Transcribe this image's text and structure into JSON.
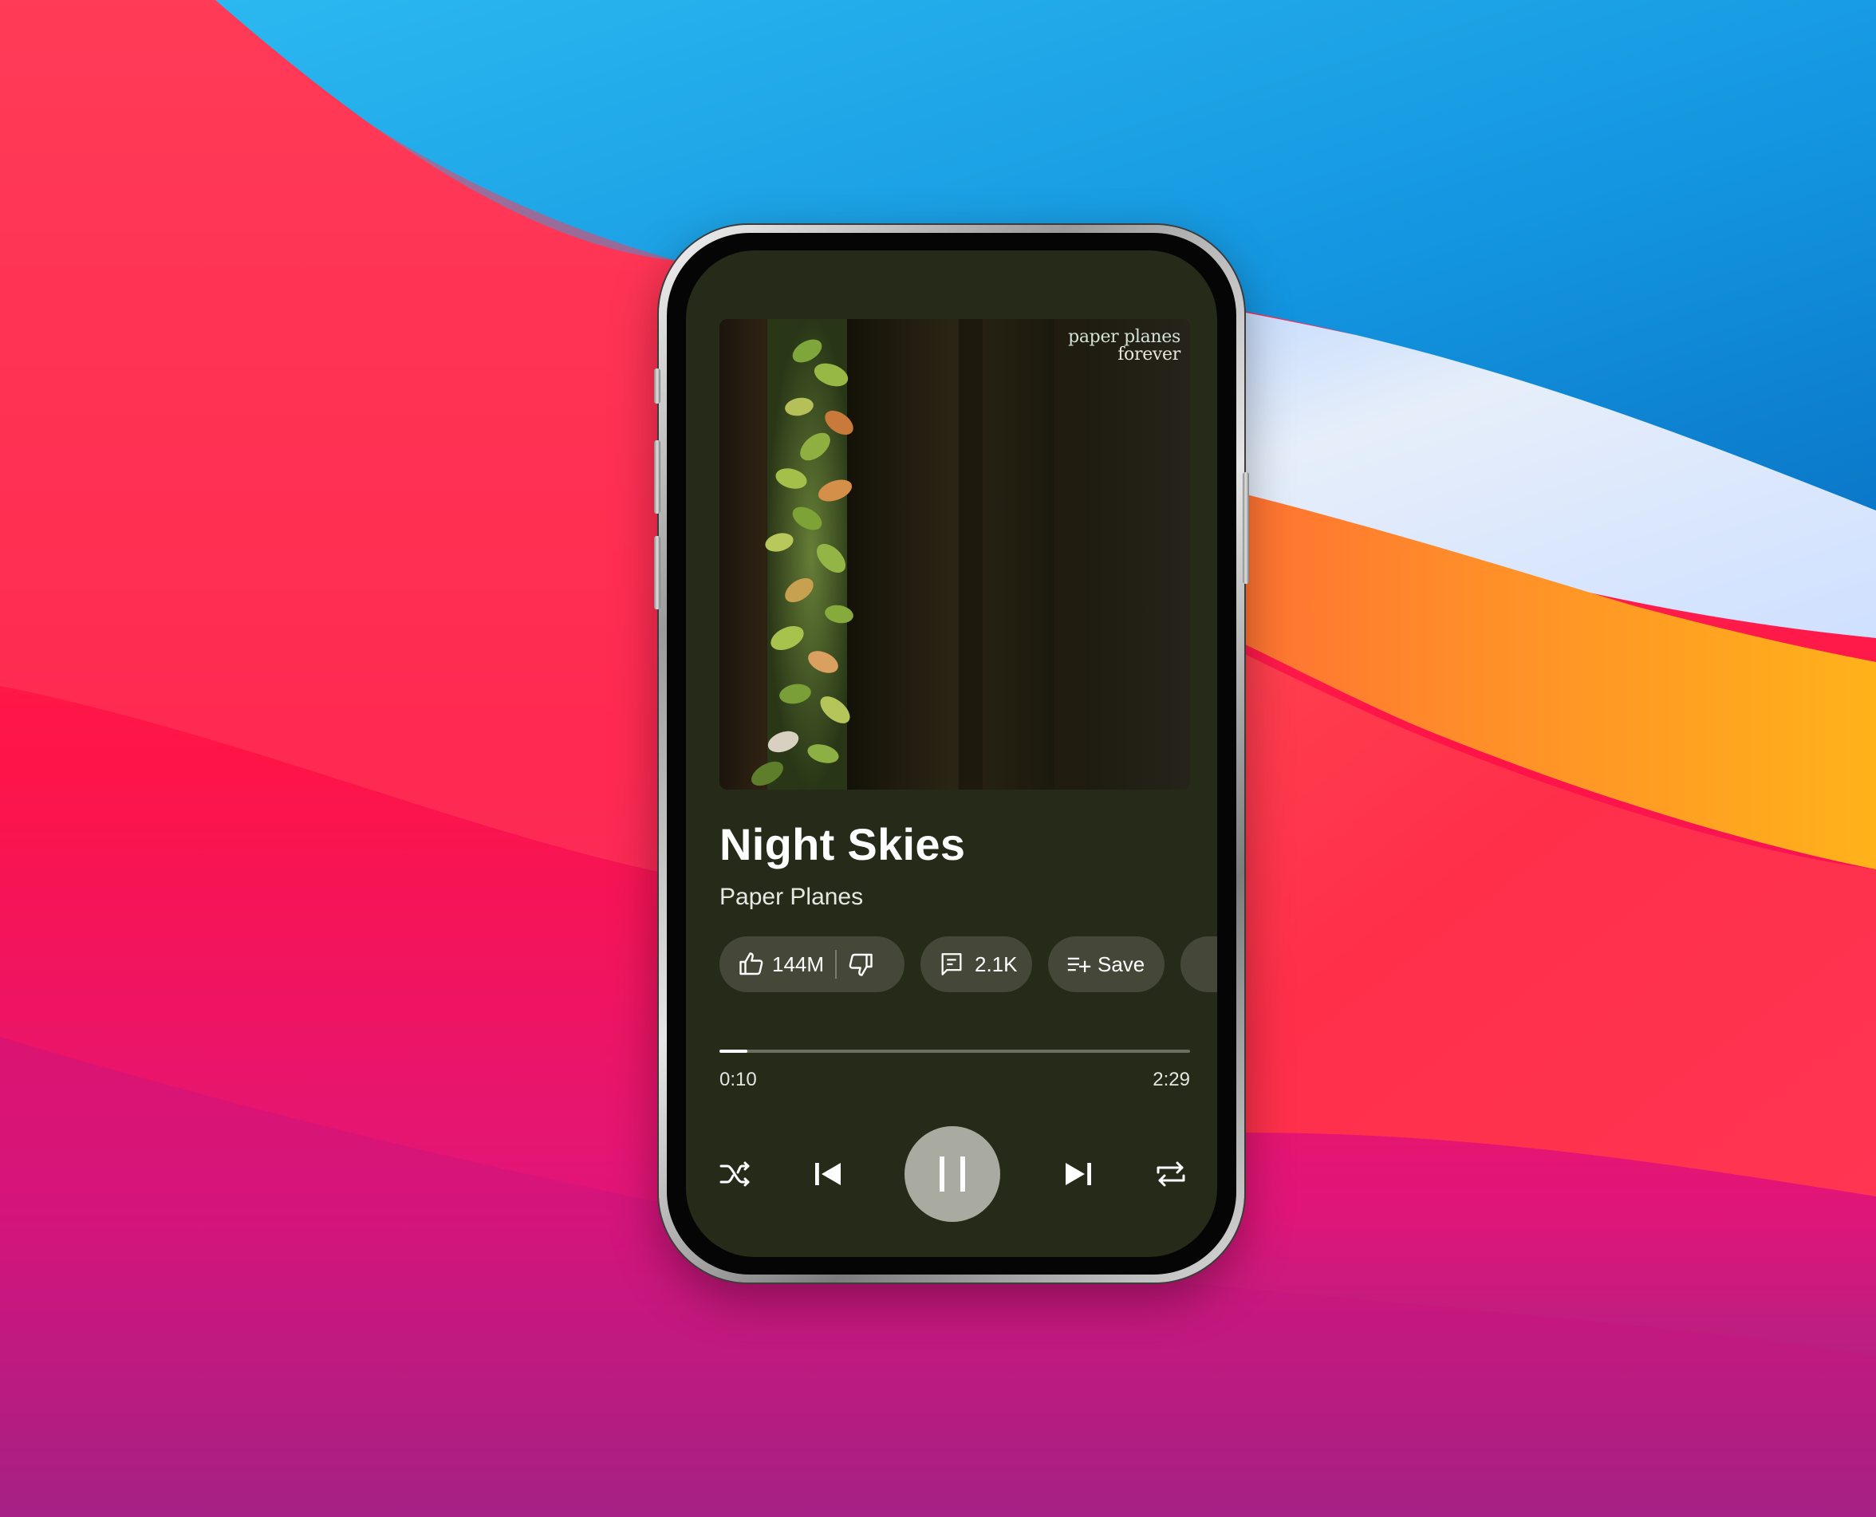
{
  "player": {
    "album_art_text": [
      "paper planes",
      "forever"
    ],
    "title": "Night Skies",
    "artist": "Paper Planes",
    "likes": "144M",
    "comments": "2.1K",
    "save_label": "Save",
    "elapsed": "0:10",
    "duration": "2:29",
    "progress": 0.06,
    "state": "playing"
  },
  "icons": {
    "like": "thumbs-up-icon",
    "dislike": "thumbs-down-icon",
    "comment": "comment-icon",
    "save": "playlist-add-icon",
    "shuffle": "shuffle-icon",
    "previous": "skip-previous-icon",
    "pause": "pause-icon",
    "next": "skip-next-icon",
    "repeat": "repeat-icon"
  },
  "colors": {
    "screen_background": "#262a18",
    "pill_background": "#454838",
    "play_button": "#a9aba0",
    "text": "#ffffff"
  }
}
